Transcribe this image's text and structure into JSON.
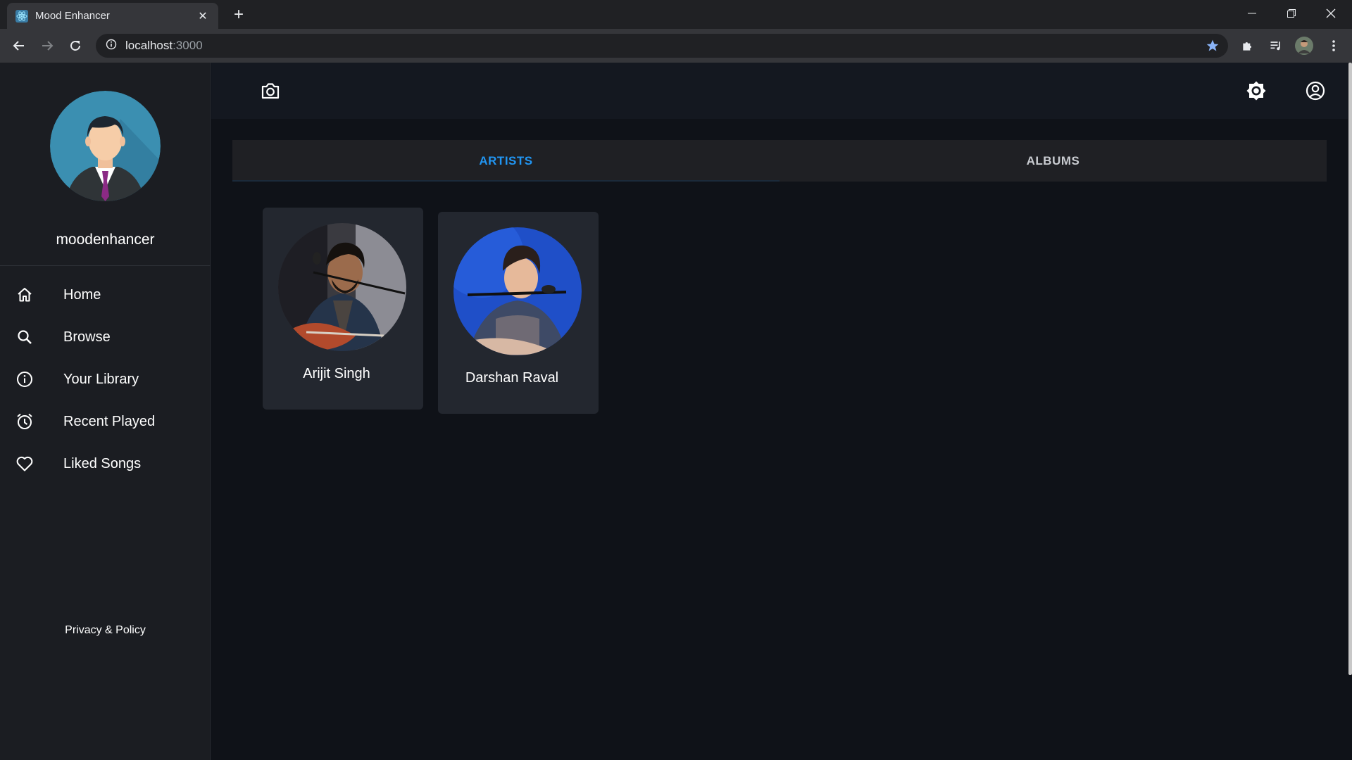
{
  "browser": {
    "tab_title": "Mood Enhancer",
    "tab_close": "✕",
    "new_tab": "+",
    "url_host": "localhost",
    "url_port": ":3000"
  },
  "sidebar": {
    "username": "moodenhancer",
    "items": [
      {
        "label": "Home",
        "icon": "home-icon"
      },
      {
        "label": "Browse",
        "icon": "search-icon"
      },
      {
        "label": "Your Library",
        "icon": "info-icon"
      },
      {
        "label": "Recent Played",
        "icon": "alarm-clock-icon"
      },
      {
        "label": "Liked Songs",
        "icon": "heart-icon"
      }
    ],
    "privacy": "Privacy & Policy"
  },
  "appbar": {
    "icons": [
      "camera-icon",
      "brightness-icon",
      "account-circle-icon"
    ]
  },
  "tabs": [
    {
      "label": "ARTISTS",
      "active": true
    },
    {
      "label": "ALBUMS",
      "active": false
    }
  ],
  "artists": [
    {
      "name": "Arijit Singh"
    },
    {
      "name": "Darshan Raval"
    }
  ],
  "colors": {
    "accent": "#2196f3",
    "background": "#0f1218",
    "sidebar": "#1b1d22",
    "card": "#23272f"
  }
}
